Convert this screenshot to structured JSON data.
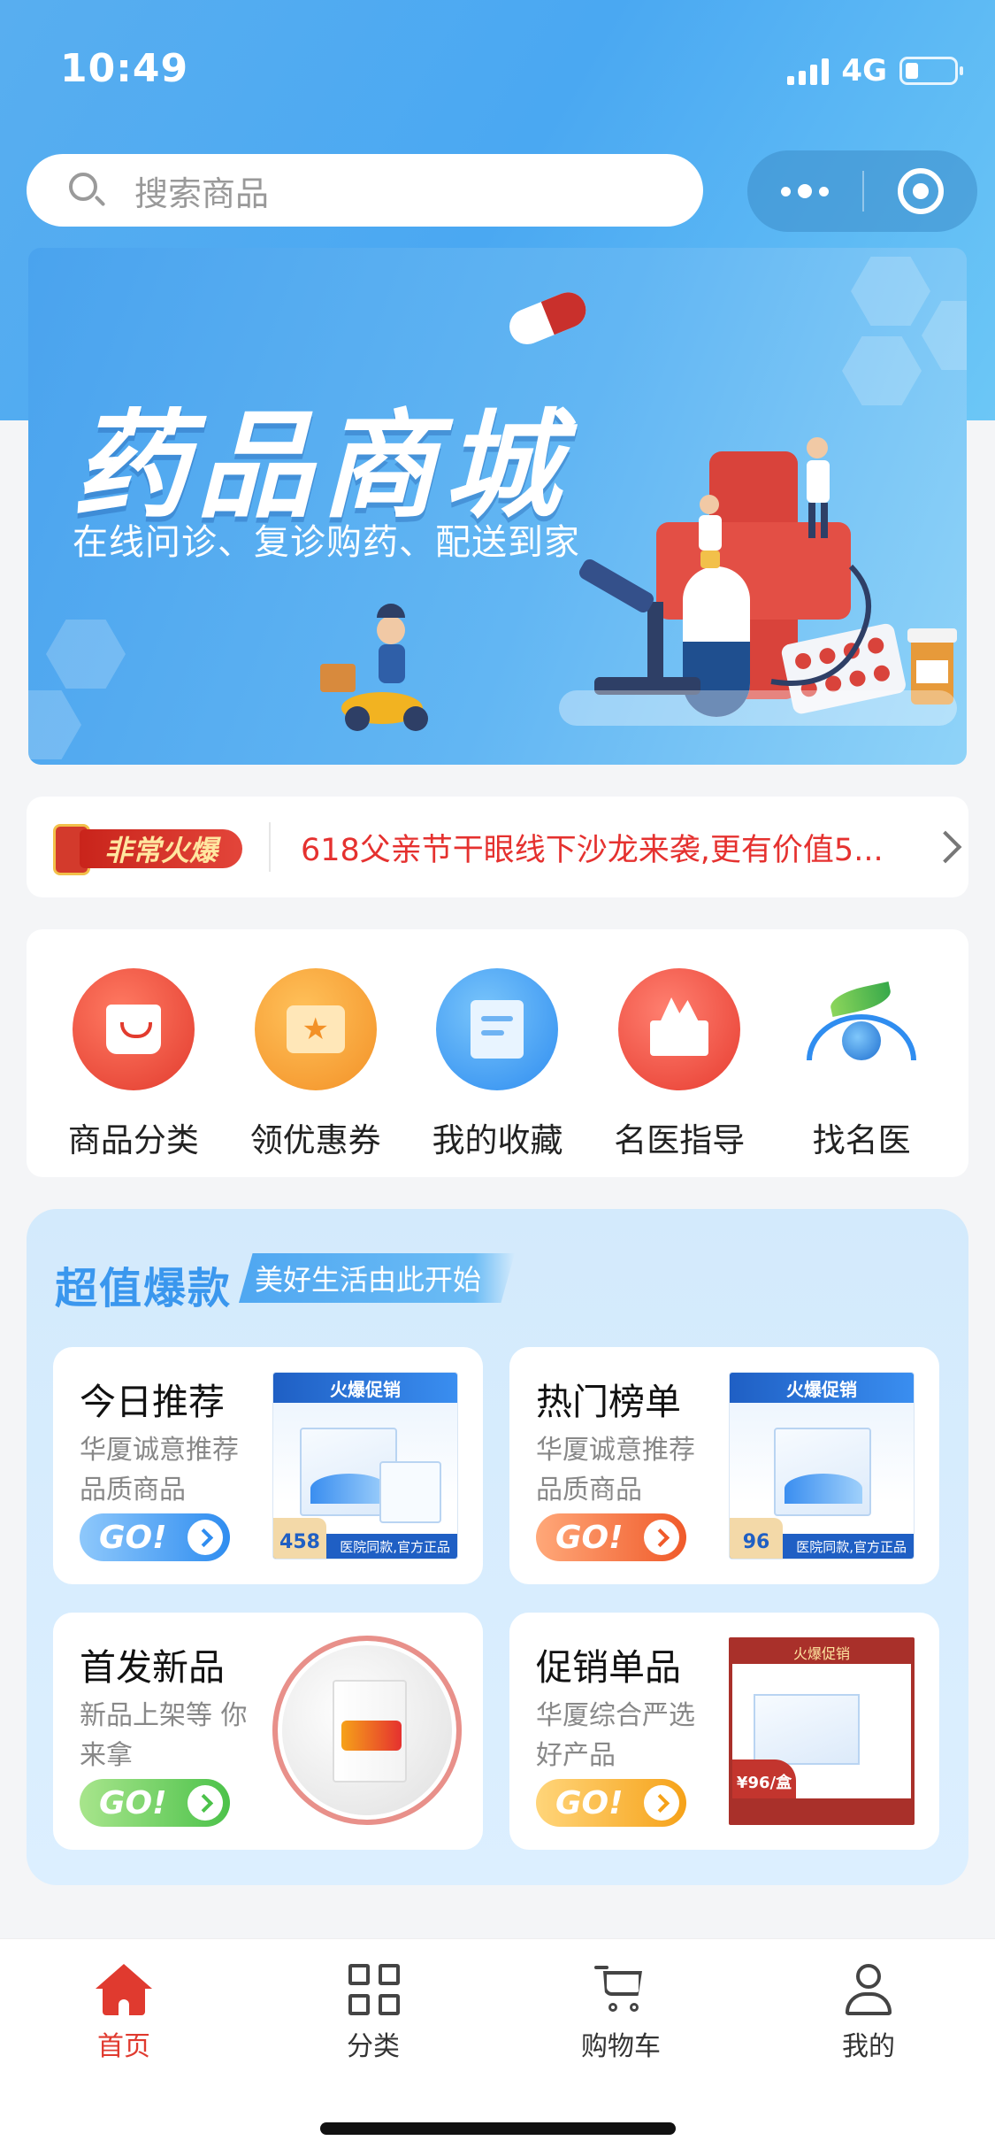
{
  "status_bar": {
    "time": "10:49",
    "network": "4G"
  },
  "search": {
    "placeholder": "搜索商品"
  },
  "banner": {
    "title": "药品商城",
    "subtitle": "在线问诊、复诊购药、配送到家"
  },
  "notice": {
    "tag": "非常火爆",
    "text": "618父亲节干眼线下沙龙来袭,更有价值5..."
  },
  "entries": [
    {
      "label": "商品分类",
      "icon": "shopping-bag-icon"
    },
    {
      "label": "领优惠券",
      "icon": "coupon-icon"
    },
    {
      "label": "我的收藏",
      "icon": "favorites-folder-icon"
    },
    {
      "label": "名医指导",
      "icon": "doctor-guide-icon"
    },
    {
      "label": "找名医",
      "icon": "eye-icon"
    }
  ],
  "featured": {
    "title": "超值爆款",
    "slogan": "美好生活由此开始",
    "go_label": "GO!",
    "cards": [
      {
        "title": "今日推荐",
        "desc": "华厦诚意推荐 品质商品",
        "img_header": "火爆促销",
        "price": "458",
        "img_footer": "医院同款,官方正品"
      },
      {
        "title": "热门榜单",
        "desc": "华厦诚意推荐 品质商品",
        "img_header": "火爆促销",
        "price": "96",
        "img_footer": "医院同款,官方正品"
      },
      {
        "title": "首发新品",
        "desc": "新品上架等 你来拿"
      },
      {
        "title": "促销单品",
        "desc": "华厦综合严选 好产品",
        "img_header": "火爆促销",
        "price": "¥96/盒"
      }
    ]
  },
  "tabbar": {
    "items": [
      {
        "label": "首页",
        "icon": "home-icon",
        "active": true
      },
      {
        "label": "分类",
        "icon": "grid-icon",
        "active": false
      },
      {
        "label": "购物车",
        "icon": "cart-icon",
        "active": false
      },
      {
        "label": "我的",
        "icon": "user-icon",
        "active": false
      }
    ]
  },
  "colors": {
    "accent": "#e03a2f",
    "primary": "#3a97ee",
    "notice_text": "#e5312f"
  }
}
